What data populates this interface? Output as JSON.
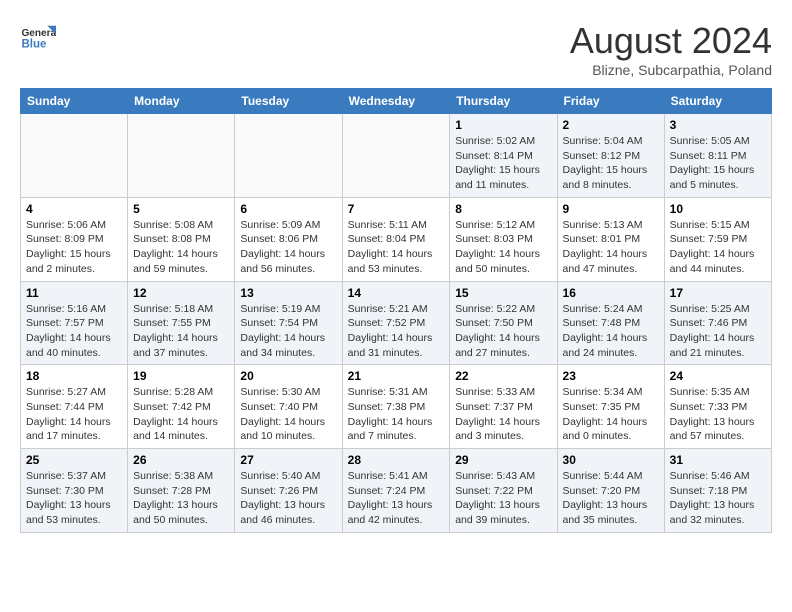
{
  "header": {
    "logo_general": "General",
    "logo_blue": "Blue",
    "month_year": "August 2024",
    "location": "Blizne, Subcarpathia, Poland"
  },
  "days_of_week": [
    "Sunday",
    "Monday",
    "Tuesday",
    "Wednesday",
    "Thursday",
    "Friday",
    "Saturday"
  ],
  "weeks": [
    [
      {
        "day": "",
        "info": ""
      },
      {
        "day": "",
        "info": ""
      },
      {
        "day": "",
        "info": ""
      },
      {
        "day": "",
        "info": ""
      },
      {
        "day": "1",
        "info": "Sunrise: 5:02 AM\nSunset: 8:14 PM\nDaylight: 15 hours and 11 minutes."
      },
      {
        "day": "2",
        "info": "Sunrise: 5:04 AM\nSunset: 8:12 PM\nDaylight: 15 hours and 8 minutes."
      },
      {
        "day": "3",
        "info": "Sunrise: 5:05 AM\nSunset: 8:11 PM\nDaylight: 15 hours and 5 minutes."
      }
    ],
    [
      {
        "day": "4",
        "info": "Sunrise: 5:06 AM\nSunset: 8:09 PM\nDaylight: 15 hours and 2 minutes."
      },
      {
        "day": "5",
        "info": "Sunrise: 5:08 AM\nSunset: 8:08 PM\nDaylight: 14 hours and 59 minutes."
      },
      {
        "day": "6",
        "info": "Sunrise: 5:09 AM\nSunset: 8:06 PM\nDaylight: 14 hours and 56 minutes."
      },
      {
        "day": "7",
        "info": "Sunrise: 5:11 AM\nSunset: 8:04 PM\nDaylight: 14 hours and 53 minutes."
      },
      {
        "day": "8",
        "info": "Sunrise: 5:12 AM\nSunset: 8:03 PM\nDaylight: 14 hours and 50 minutes."
      },
      {
        "day": "9",
        "info": "Sunrise: 5:13 AM\nSunset: 8:01 PM\nDaylight: 14 hours and 47 minutes."
      },
      {
        "day": "10",
        "info": "Sunrise: 5:15 AM\nSunset: 7:59 PM\nDaylight: 14 hours and 44 minutes."
      }
    ],
    [
      {
        "day": "11",
        "info": "Sunrise: 5:16 AM\nSunset: 7:57 PM\nDaylight: 14 hours and 40 minutes."
      },
      {
        "day": "12",
        "info": "Sunrise: 5:18 AM\nSunset: 7:55 PM\nDaylight: 14 hours and 37 minutes."
      },
      {
        "day": "13",
        "info": "Sunrise: 5:19 AM\nSunset: 7:54 PM\nDaylight: 14 hours and 34 minutes."
      },
      {
        "day": "14",
        "info": "Sunrise: 5:21 AM\nSunset: 7:52 PM\nDaylight: 14 hours and 31 minutes."
      },
      {
        "day": "15",
        "info": "Sunrise: 5:22 AM\nSunset: 7:50 PM\nDaylight: 14 hours and 27 minutes."
      },
      {
        "day": "16",
        "info": "Sunrise: 5:24 AM\nSunset: 7:48 PM\nDaylight: 14 hours and 24 minutes."
      },
      {
        "day": "17",
        "info": "Sunrise: 5:25 AM\nSunset: 7:46 PM\nDaylight: 14 hours and 21 minutes."
      }
    ],
    [
      {
        "day": "18",
        "info": "Sunrise: 5:27 AM\nSunset: 7:44 PM\nDaylight: 14 hours and 17 minutes."
      },
      {
        "day": "19",
        "info": "Sunrise: 5:28 AM\nSunset: 7:42 PM\nDaylight: 14 hours and 14 minutes."
      },
      {
        "day": "20",
        "info": "Sunrise: 5:30 AM\nSunset: 7:40 PM\nDaylight: 14 hours and 10 minutes."
      },
      {
        "day": "21",
        "info": "Sunrise: 5:31 AM\nSunset: 7:38 PM\nDaylight: 14 hours and 7 minutes."
      },
      {
        "day": "22",
        "info": "Sunrise: 5:33 AM\nSunset: 7:37 PM\nDaylight: 14 hours and 3 minutes."
      },
      {
        "day": "23",
        "info": "Sunrise: 5:34 AM\nSunset: 7:35 PM\nDaylight: 14 hours and 0 minutes."
      },
      {
        "day": "24",
        "info": "Sunrise: 5:35 AM\nSunset: 7:33 PM\nDaylight: 13 hours and 57 minutes."
      }
    ],
    [
      {
        "day": "25",
        "info": "Sunrise: 5:37 AM\nSunset: 7:30 PM\nDaylight: 13 hours and 53 minutes."
      },
      {
        "day": "26",
        "info": "Sunrise: 5:38 AM\nSunset: 7:28 PM\nDaylight: 13 hours and 50 minutes."
      },
      {
        "day": "27",
        "info": "Sunrise: 5:40 AM\nSunset: 7:26 PM\nDaylight: 13 hours and 46 minutes."
      },
      {
        "day": "28",
        "info": "Sunrise: 5:41 AM\nSunset: 7:24 PM\nDaylight: 13 hours and 42 minutes."
      },
      {
        "day": "29",
        "info": "Sunrise: 5:43 AM\nSunset: 7:22 PM\nDaylight: 13 hours and 39 minutes."
      },
      {
        "day": "30",
        "info": "Sunrise: 5:44 AM\nSunset: 7:20 PM\nDaylight: 13 hours and 35 minutes."
      },
      {
        "day": "31",
        "info": "Sunrise: 5:46 AM\nSunset: 7:18 PM\nDaylight: 13 hours and 32 minutes."
      }
    ]
  ]
}
